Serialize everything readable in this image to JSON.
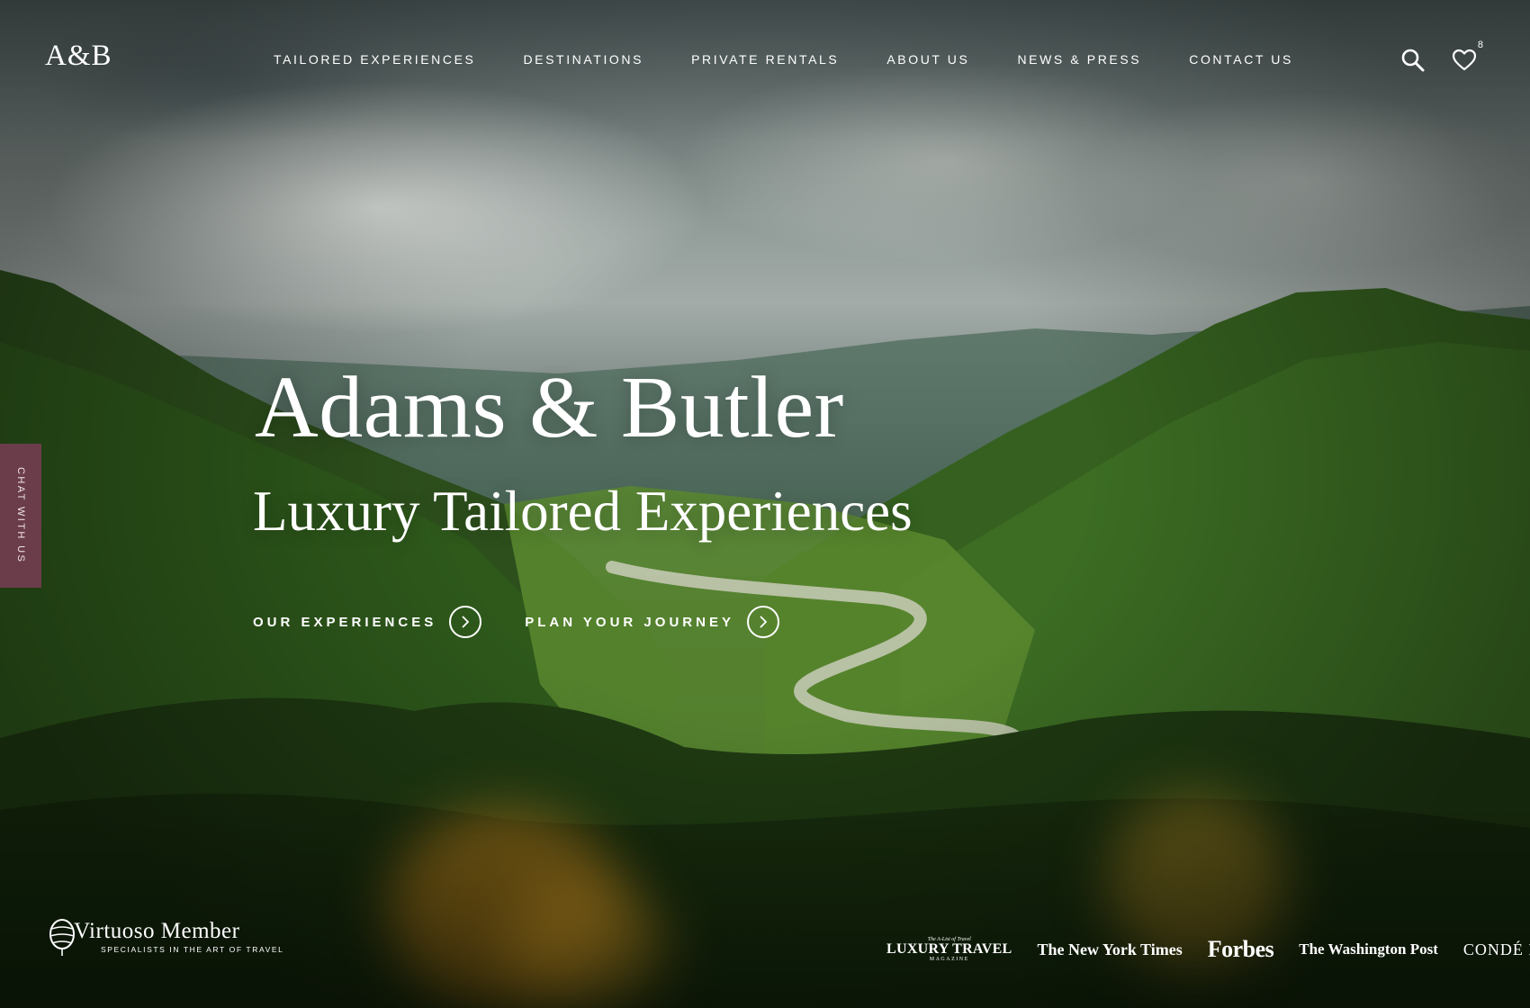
{
  "header": {
    "logo": "A&B",
    "nav": [
      "TAILORED EXPERIENCES",
      "DESTINATIONS",
      "PRIVATE RENTALS",
      "ABOUT US",
      "NEWS & PRESS",
      "CONTACT US"
    ],
    "search_icon": "search-icon",
    "favorites_icon": "heart-icon",
    "favorites_count": "8"
  },
  "chat_tab": {
    "label": "CHAT WITH US"
  },
  "hero": {
    "title": "Adams & Butler",
    "subtitle": "Luxury Tailored Experiences",
    "ctas": [
      {
        "label": "OUR EXPERIENCES",
        "icon": "chevron-right-icon"
      },
      {
        "label": "PLAN YOUR JOURNEY",
        "icon": "chevron-right-icon"
      }
    ]
  },
  "footer": {
    "virtuoso": {
      "main": "Virtuoso Member",
      "sub": "SPECIALISTS IN THE ART OF TRAVEL"
    },
    "press": {
      "luxury_travel_top": "The A-List of Travel",
      "luxury_travel_main": "LUXURY TRAVEL",
      "luxury_travel_bottom": "MAGAZINE",
      "nyt": "The New York Times",
      "forbes": "Forbes",
      "wapo": "The Washington Post",
      "conde": "CONDÉ NAST"
    }
  },
  "colors": {
    "chat_tab_bg": "#6b3d4a",
    "text": "#ffffff"
  }
}
